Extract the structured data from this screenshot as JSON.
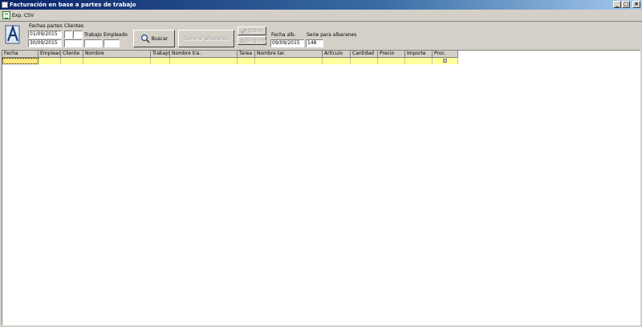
{
  "window": {
    "title": "Facturación en base a partes de trabajo",
    "minimize_glyph": "_",
    "maximize_glyph": "□",
    "close_glyph": "×"
  },
  "menu": {
    "export_label": "Exp. CSV"
  },
  "filters": {
    "fechas_partes_label": "Fechas partes",
    "fecha_desde": "01/09/2015",
    "fecha_hasta": "30/09/2015",
    "clientes_label": "Clientes",
    "trabajo_label": "Trabajo",
    "empleado_label": "Empleado"
  },
  "actions": {
    "buscar_label": "Buscar",
    "generar_label": "Generar albaranes",
    "todos_label": "Todos",
    "ninguno_label": "Ninguno"
  },
  "albaran": {
    "fecha_label": "Fecha alb.",
    "fecha_value": "09/09/2015",
    "serie_label": "Serie para albaranes",
    "serie_value": "148"
  },
  "grid": {
    "columns": [
      "Fecha",
      "Empleado",
      "Cliente",
      "Nombre",
      "Trabajo",
      "Nombre tra.",
      "Tarea",
      "Nombre tar.",
      "Artículo",
      "Cantidad",
      "Precio",
      "Importe",
      "Proc."
    ]
  },
  "colors": {
    "row_highlight": "#ffff9c",
    "title_bar": "#0a246a"
  },
  "icons": [
    "app-icon",
    "csv-export-icon",
    "logo-icon",
    "search-icon",
    "check-all-icon",
    "uncheck-all-icon"
  ]
}
